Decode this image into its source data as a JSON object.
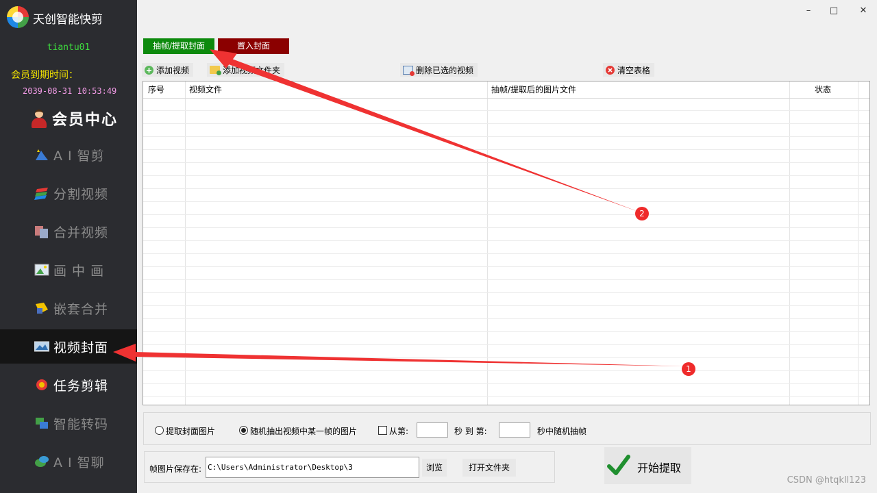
{
  "app": {
    "title": "天创智能快剪"
  },
  "user": {
    "name": "tiantu01",
    "member_label": "会员到期时间：",
    "expire": "2039-08-31 10:53:49"
  },
  "sidebar": {
    "member_center": "会员中心",
    "items": [
      {
        "label": "A I 智剪",
        "icon": "ai-cut-icon"
      },
      {
        "label": "分割视频",
        "icon": "split-video-icon"
      },
      {
        "label": "合并视频",
        "icon": "merge-video-icon"
      },
      {
        "label": "画 中 画",
        "icon": "picture-in-picture-icon"
      },
      {
        "label": "嵌套合并",
        "icon": "nest-merge-icon"
      },
      {
        "label": "视频封面",
        "icon": "video-cover-icon",
        "active": true
      },
      {
        "label": "任务剪辑",
        "icon": "task-edit-icon"
      },
      {
        "label": "智能转码",
        "icon": "transcode-icon"
      },
      {
        "label": "A I 智聊",
        "icon": "ai-chat-icon"
      }
    ]
  },
  "window": {
    "minimize": "–",
    "maximize": "□",
    "close": "✕"
  },
  "tabs": [
    {
      "label": "抽帧/提取封面"
    },
    {
      "label": "置入封面"
    }
  ],
  "toolbar": {
    "add_video": "添加视频",
    "add_folder": "添加视频文件夹",
    "delete_selected": "删除已选的视频",
    "clear_table": "清空表格"
  },
  "table": {
    "columns": [
      "序号",
      "视频文件",
      "抽帧/提取后的图片文件",
      "状态"
    ]
  },
  "options": {
    "extract_cover": "提取封面图片",
    "random_frame": "随机抽出视频中某一帧的图片",
    "from_label": "从第:",
    "sec_to": "秒 到 第:",
    "random_suffix": "秒中随机抽帧"
  },
  "save": {
    "label": "帧图片保存在:",
    "path": "C:\\Users\\Administrator\\Desktop\\3",
    "browse": "浏览",
    "open_folder": "打开文件夹"
  },
  "start": {
    "label": "开始提取"
  },
  "annotations": {
    "one": "1",
    "two": "2"
  },
  "watermark": "CSDN @htqkll123",
  "colors": {
    "sidebar_bg": "#2b2c30",
    "tab_extract": "#0d8a0d",
    "tab_insert": "#8b0000",
    "annotation": "#ef2b2b"
  }
}
